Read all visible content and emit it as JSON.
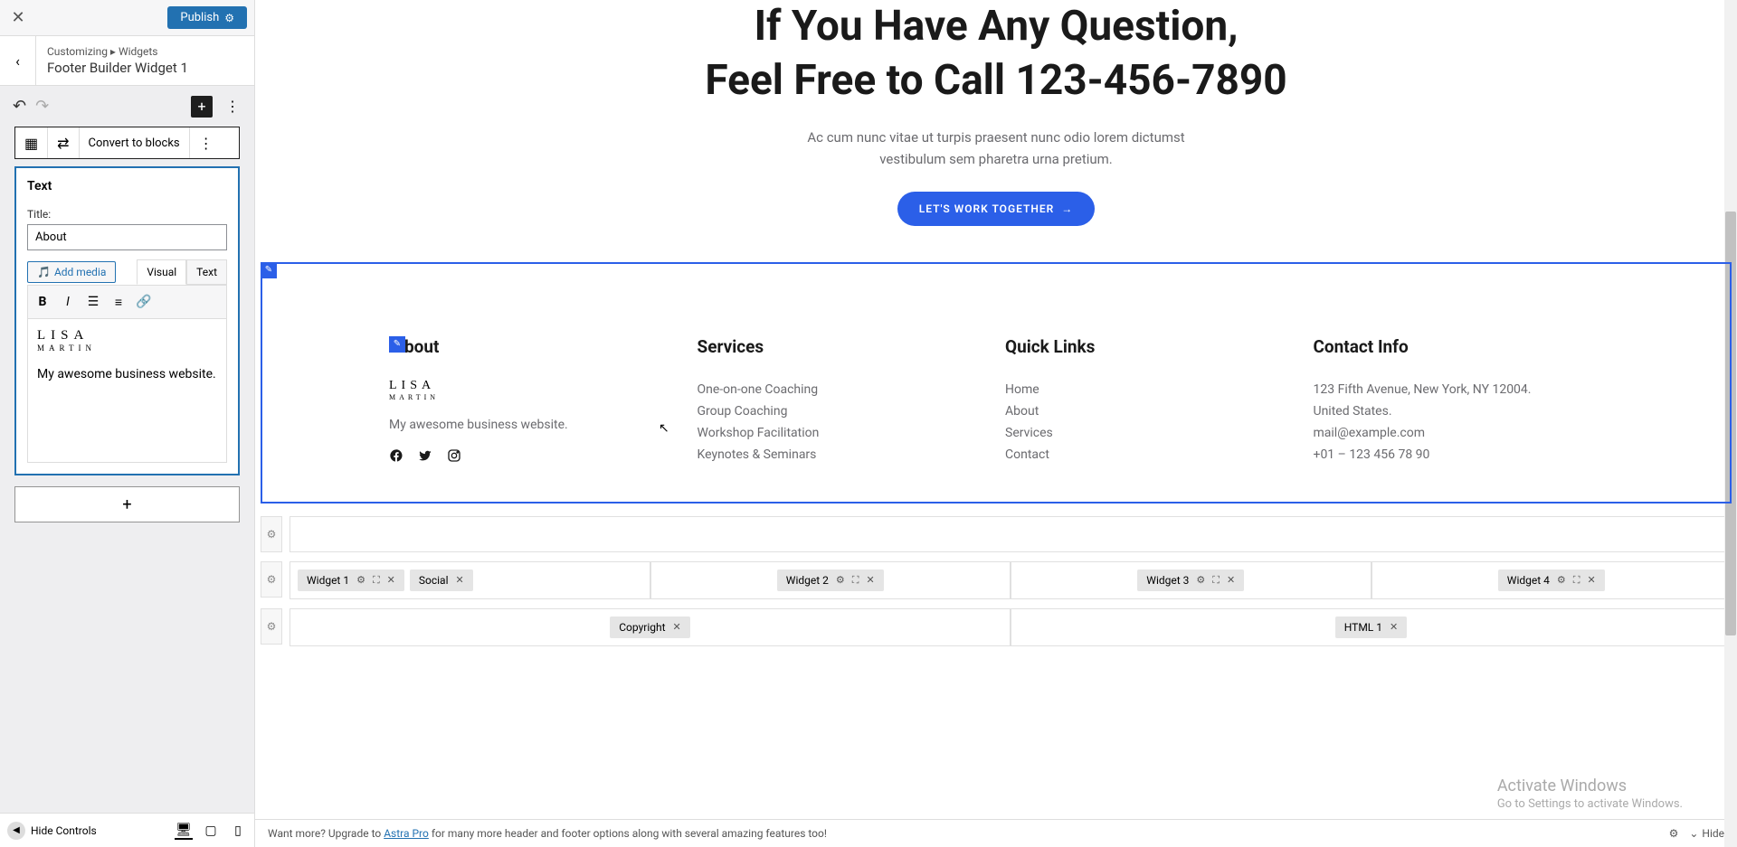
{
  "sidebar": {
    "publish_label": "Publish",
    "breadcrumb_prefix": "Customizing",
    "breadcrumb_section": "Widgets",
    "breadcrumb_title": "Footer Builder Widget 1",
    "convert_label": "Convert to blocks",
    "widget_type": "Text",
    "title_label": "Title:",
    "title_value": "About",
    "add_media_label": "Add media",
    "tab_visual": "Visual",
    "tab_text": "Text",
    "logo_main": "LISA",
    "logo_sub": "MARTIN",
    "body_text": "My awesome business website.",
    "hide_controls": "Hide Controls"
  },
  "hero": {
    "title_line1": "If You Have Any Question,",
    "title_line2": "Feel Free to Call 123-456-7890",
    "desc_line1": "Ac cum nunc vitae ut turpis praesent nunc odio lorem dictumst",
    "desc_line2": "vestibulum sem pharetra urna pretium.",
    "cta": "LET'S WORK TOGETHER"
  },
  "footer": {
    "about": {
      "heading": "About",
      "logo_main": "LISA",
      "logo_sub": "MARTIN",
      "text": "My awesome business website."
    },
    "services": {
      "heading": "Services",
      "items": [
        "One-on-one Coaching",
        "Group Coaching",
        "Workshop Facilitation",
        "Keynotes & Seminars"
      ]
    },
    "quicklinks": {
      "heading": "Quick Links",
      "items": [
        "Home",
        "About",
        "Services",
        "Contact"
      ]
    },
    "contact": {
      "heading": "Contact Info",
      "items": [
        "123 Fifth Avenue, New York, NY 12004.",
        "United States.",
        "mail@example.com",
        "+01 – 123 456 78 90"
      ]
    }
  },
  "builder": {
    "widget1": "Widget 1",
    "social": "Social",
    "widget2": "Widget 2",
    "widget3": "Widget 3",
    "widget4": "Widget 4",
    "copyright": "Copyright",
    "html1": "HTML 1"
  },
  "bottombar": {
    "prefix": "Want more? Upgrade to ",
    "link": "Astra Pro",
    "suffix": " for many more header and footer options along with several amazing features too!",
    "hide": "Hide"
  },
  "watermark": {
    "title": "Activate Windows",
    "sub": "Go to Settings to activate Windows."
  }
}
